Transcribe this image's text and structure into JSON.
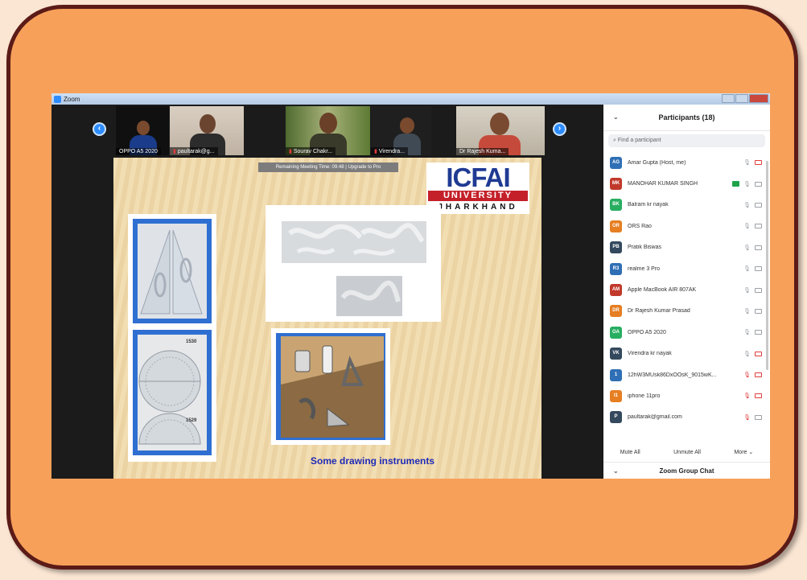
{
  "window": {
    "title": "Zoom"
  },
  "gallery": {
    "prev_arrow": "‹",
    "next_arrow": "›",
    "tiles": [
      {
        "name": "OPPO A5 2020"
      },
      {
        "name": "paultarak@g..."
      },
      {
        "name": "Sourav Chakr..."
      },
      {
        "name": "Virendra..."
      },
      {
        "name": "Dr Rajesh Kuma..."
      }
    ]
  },
  "slide": {
    "timer_banner": "Remaining Meeting Time: 09:48 | Upgrade to Pro",
    "logo": {
      "line1": "ICFAI",
      "line2": "UNIVERSITY",
      "line3": "JHARKHAND"
    },
    "protractor_labels": [
      "1530",
      "1529"
    ],
    "caption": "Some drawing instruments"
  },
  "participants": {
    "header": "Participants (18)",
    "search_placeholder": "Find a participant",
    "list": [
      {
        "initials": "AG",
        "name": "Amar Gupta (Host, me)",
        "color": "#2f6fb5",
        "mic": "on",
        "video": "off",
        "share": false
      },
      {
        "initials": "MK",
        "name": "MANOHAR KUMAR SINGH",
        "color": "#c0392b",
        "mic": "on",
        "video": "on",
        "share": true
      },
      {
        "initials": "BK",
        "name": "Balram kr nayak",
        "color": "#27ae60",
        "mic": "on",
        "video": "on",
        "share": false
      },
      {
        "initials": "OR",
        "name": "ORS Rao",
        "color": "#e67e22",
        "mic": "on",
        "video": "on",
        "share": false
      },
      {
        "initials": "PB",
        "name": "Pratik Biswas",
        "color": "#34495e",
        "mic": "on",
        "video": "on",
        "share": false
      },
      {
        "initials": "R3",
        "name": "realme 3 Pro",
        "color": "#2f6fb5",
        "mic": "on",
        "video": "on",
        "share": false
      },
      {
        "initials": "AM",
        "name": "Apple MacBook AIR 807AK",
        "color": "#c0392b",
        "mic": "on",
        "video": "on",
        "share": false
      },
      {
        "initials": "DR",
        "name": "Dr Rajesh Kumar Prasad",
        "color": "#e67e22",
        "mic": "on",
        "video": "on",
        "share": false
      },
      {
        "initials": "OA",
        "name": "OPPO A5 2020",
        "color": "#27ae60",
        "mic": "on",
        "video": "on",
        "share": false
      },
      {
        "initials": "VK",
        "name": "Virendra kr nayak",
        "color": "#34495e",
        "mic": "on",
        "video": "off",
        "share": false
      },
      {
        "initials": "1",
        "name": "12hW3MUsk86DxOOsK_9015wK...",
        "color": "#2f6fb5",
        "mic": "off",
        "video": "off",
        "share": false
      },
      {
        "initials": "I1",
        "name": "iphone 11pro",
        "color": "#e67e22",
        "mic": "off",
        "video": "off",
        "share": false
      },
      {
        "initials": "P",
        "name": "paultarak@gmail.com",
        "color": "#34495e",
        "mic": "off",
        "video": "on",
        "share": false
      }
    ],
    "actions": {
      "mute_all": "Mute All",
      "unmute_all": "Unmute All",
      "more": "More ⌄"
    }
  },
  "chat": {
    "header": "Zoom Group Chat"
  },
  "colors": {
    "frame_fill": "#f7a05a",
    "frame_border": "#5b1b17",
    "zoom_blue": "#2d8cff"
  }
}
